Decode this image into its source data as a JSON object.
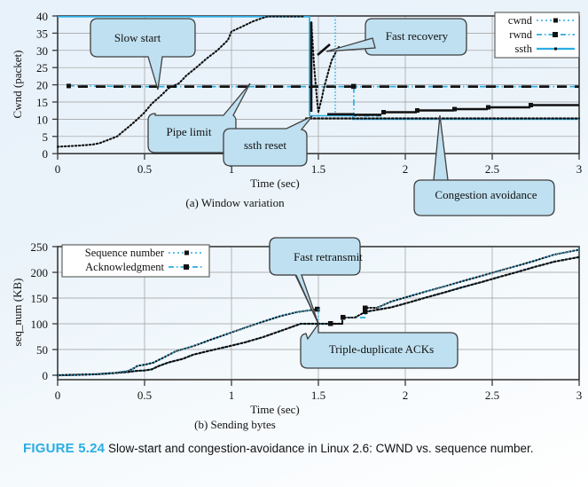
{
  "figure": {
    "number_label": "FIGURE 5.24",
    "caption_text": "Slow-start and congestion-avoidance in Linux 2.6: CWND vs. sequence number.",
    "accent_color": "#29ADE4",
    "bubble_fill": "#bfe0f0",
    "background_color": "#eaf3fa"
  },
  "panel_a": {
    "caption": "(a) Window variation",
    "xlabel": "Time (sec)",
    "ylabel": "Cwnd (packet)",
    "xticks": [
      "0",
      "0.5",
      "1",
      "1.5",
      "2",
      "2.5",
      "3"
    ],
    "yticks": [
      "0",
      "5",
      "10",
      "15",
      "20",
      "25",
      "30",
      "35",
      "40"
    ],
    "legend": [
      {
        "label": "cwnd",
        "style": "dotted-square-black"
      },
      {
        "label": "rwnd",
        "style": "dashdot-square-cyan"
      },
      {
        "label": "ssth",
        "style": "solid-cyan"
      }
    ],
    "callouts": [
      {
        "label": "Slow start"
      },
      {
        "label": "Pipe limit"
      },
      {
        "label": "ssth reset"
      },
      {
        "label": "Fast recovery"
      },
      {
        "label": "Congestion avoidance"
      }
    ]
  },
  "panel_b": {
    "caption": "(b) Sending bytes",
    "xlabel": "Time (sec)",
    "ylabel": "seq_num (KB)",
    "xticks": [
      "0",
      "0.5",
      "1",
      "1.5",
      "2",
      "2.5",
      "3"
    ],
    "yticks": [
      "0",
      "50",
      "100",
      "150",
      "200",
      "250"
    ],
    "legend": [
      {
        "label": "Sequence number",
        "style": "dotted-square-black"
      },
      {
        "label": "Acknowledgment",
        "style": "dashdot-square-cyan"
      }
    ],
    "callouts": [
      {
        "label": "Fast retransmit"
      },
      {
        "label": "Triple-duplicate ACKs"
      }
    ]
  },
  "chart_data": [
    {
      "type": "line",
      "title": "(a) Window variation",
      "xlabel": "Time (sec)",
      "ylabel": "Cwnd (packet)",
      "xlim": [
        0,
        3
      ],
      "ylim": [
        0,
        40
      ],
      "xticks": [
        0,
        0.5,
        1,
        1.5,
        2,
        2.5,
        3
      ],
      "yticks": [
        0,
        5,
        10,
        15,
        20,
        25,
        30,
        35,
        40
      ],
      "grid": true,
      "legend_position": "top-right",
      "series": [
        {
          "name": "cwnd",
          "style": "dotted-square-black",
          "x": [
            0.0,
            0.12,
            0.2,
            0.24,
            0.3,
            0.34,
            0.38,
            0.42,
            0.46,
            0.5,
            0.54,
            0.58,
            0.62,
            0.66,
            0.72,
            0.78,
            0.84,
            0.9,
            0.96,
            1.0,
            1.06,
            1.12,
            1.18,
            1.24,
            1.3,
            1.36,
            1.42,
            1.46,
            1.48,
            1.49,
            1.5,
            1.505,
            1.51,
            1.515,
            1.52,
            1.53,
            1.54,
            1.55,
            1.56,
            1.58,
            1.6,
            1.62,
            1.66,
            1.7,
            1.74,
            1.8,
            1.86,
            1.92,
            2.0,
            2.08,
            2.16,
            2.24,
            2.3,
            2.36,
            2.44,
            2.52,
            2.6,
            2.68,
            2.74,
            2.82,
            2.9,
            3.0
          ],
          "y": [
            2,
            2.3,
            2.6,
            3,
            4.2,
            5,
            6.5,
            8.2,
            10,
            12,
            14.5,
            17,
            19,
            20.5,
            22.5,
            25,
            27.5,
            30,
            33,
            35.5,
            37,
            38.5,
            39.5,
            40,
            40,
            40,
            40,
            38,
            34,
            30,
            26,
            22,
            19,
            16,
            13,
            11,
            12,
            14,
            17,
            20,
            23,
            26,
            28,
            22,
            11,
            11.5,
            12,
            12,
            12.5,
            13,
            13,
            13.5,
            14,
            14,
            14.5,
            14.5,
            15,
            15,
            15.5,
            16,
            16,
            16
          ]
        },
        {
          "name": "rwnd",
          "style": "dashdot-square-cyan",
          "x": [
            0.1,
            0.4,
            0.8,
            1.2,
            1.5,
            1.7,
            1.705,
            1.75,
            2.0,
            2.4,
            2.8,
            3.0
          ],
          "y": [
            22,
            21.3,
            21,
            21,
            21,
            21,
            21,
            21,
            21,
            21,
            21,
            21
          ]
        },
        {
          "name": "ssth",
          "style": "solid-cyan",
          "x": [
            0.0,
            1.45,
            1.5,
            1.7,
            1.74,
            2.0,
            2.5,
            3.0
          ],
          "y": [
            40,
            40,
            11,
            11,
            10,
            10,
            10,
            10
          ]
        }
      ],
      "annotations": [
        {
          "text": "Slow start",
          "points_to_x": 0.58,
          "points_to_y": 19
        },
        {
          "text": "Pipe limit",
          "points_to_x": 1.0,
          "points_to_y": 21
        },
        {
          "text": "ssth reset",
          "points_to_x": 1.48,
          "points_to_y": 11
        },
        {
          "text": "Fast recovery",
          "points_to_x": 1.55,
          "points_to_y": 27
        },
        {
          "text": "Congestion avoidance",
          "points_to_x": 2.32,
          "points_to_y": 13.5
        }
      ]
    },
    {
      "type": "line",
      "title": "(b) Sending bytes",
      "xlabel": "Time (sec)",
      "ylabel": "seq_num (KB)",
      "xlim": [
        0,
        3
      ],
      "ylim": [
        0,
        260
      ],
      "xticks": [
        0,
        0.5,
        1,
        1.5,
        2,
        2.5,
        3
      ],
      "yticks": [
        0,
        50,
        100,
        150,
        200,
        250
      ],
      "grid": true,
      "legend_position": "top-left",
      "series": [
        {
          "name": "Sequence number",
          "style": "dotted-square-black",
          "x": [
            0.0,
            0.12,
            0.22,
            0.32,
            0.4,
            0.44,
            0.46,
            0.5,
            0.55,
            0.62,
            0.7,
            0.8,
            0.9,
            1.0,
            1.1,
            1.2,
            1.3,
            1.4,
            1.5,
            1.55,
            1.6,
            1.66,
            1.7,
            1.76,
            1.82,
            1.86,
            1.92,
            2.0,
            2.1,
            2.2,
            2.3,
            2.4,
            2.5,
            2.6,
            2.7,
            2.8,
            2.9,
            3.0
          ],
          "y": [
            0,
            1,
            2,
            4,
            8,
            14,
            18,
            20,
            24,
            36,
            46,
            56,
            68,
            80,
            92,
            103,
            114,
            122,
            128,
            104,
            104,
            112,
            118,
            126,
            136,
            145,
            152,
            162,
            172,
            182,
            190,
            198,
            208,
            218,
            228,
            238,
            248,
            258
          ]
        },
        {
          "name": "Acknowledgment",
          "style": "dashdot-square-cyan",
          "x": [
            0.0,
            0.12,
            0.22,
            0.32,
            0.4,
            0.46,
            0.52,
            0.58,
            0.66,
            0.74,
            0.82,
            0.92,
            1.02,
            1.12,
            1.22,
            1.32,
            1.42,
            1.5,
            1.56,
            1.62,
            1.68,
            1.74,
            1.8,
            1.88,
            1.96,
            2.06,
            2.16,
            2.26,
            2.36,
            2.46,
            2.56,
            2.66,
            2.76,
            2.86,
            2.96,
            3.0
          ],
          "y": [
            0,
            1,
            2,
            4,
            6,
            8,
            9,
            12,
            18,
            24,
            30,
            38,
            46,
            54,
            62,
            72,
            84,
            100,
            100,
            100,
            112,
            114,
            122,
            132,
            142,
            152,
            162,
            170,
            180,
            190,
            200,
            210,
            220,
            230,
            240,
            244
          ]
        }
      ],
      "annotations": [
        {
          "text": "Fast retransmit",
          "points_to_x": 1.53,
          "points_to_y": 103
        },
        {
          "text": "Triple-duplicate ACKs",
          "points_to_x": 1.52,
          "points_to_y": 100
        }
      ]
    }
  ]
}
